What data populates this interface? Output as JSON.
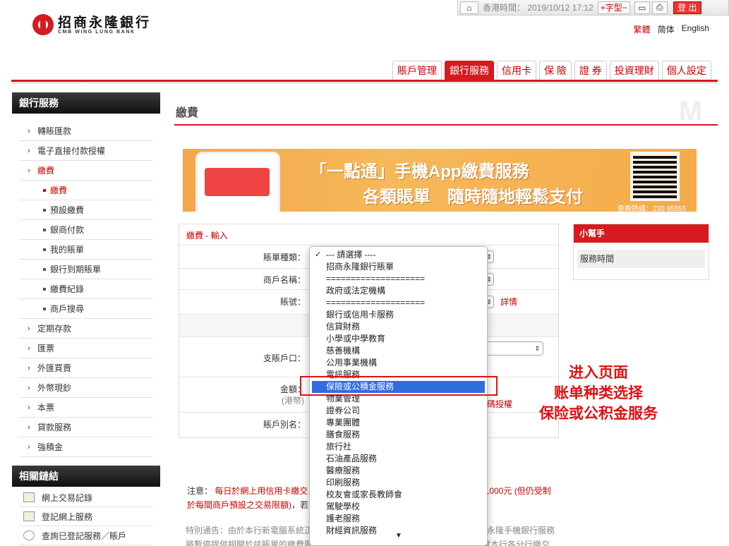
{
  "header": {
    "logo_cn": "招商永隆銀行",
    "logo_en": "CMB WING LUNG BANK",
    "clock": "香港時間： 2019/10/12 17:12",
    "font_label": "字型",
    "logout_label": "登 出",
    "lang": {
      "tc": "繁體",
      "sc": "简体",
      "en": "English"
    }
  },
  "nav": {
    "tabs": [
      "賬戶管理",
      "銀行服務",
      "信用卡",
      "保 險",
      "證 券",
      "投資理財",
      "個人設定"
    ],
    "active": "銀行服務"
  },
  "sidebar": {
    "title": "銀行服務",
    "items": [
      {
        "label": "轉賬匯款"
      },
      {
        "label": "電子直接付款授權"
      },
      {
        "label": "繳費"
      }
    ],
    "sub_items": [
      "繳費",
      "預設繳費",
      "銀商付款",
      "我的賬單",
      "銀行到期賬單",
      "繳費紀錄",
      "商戶搜尋"
    ],
    "more_items": [
      "定期存款",
      "匯票",
      "外匯買賣",
      "外幣現鈔",
      "本票",
      "貸款服務",
      "強積金"
    ],
    "links_title": "相關鏈結",
    "links": [
      "網上交易記錄",
      "登記網上服務",
      "查詢已登記服務／賬戶"
    ]
  },
  "main": {
    "page_title": "繳費",
    "banner": {
      "line1": "「一點通」手機App繳費服務",
      "line2": "各類賬單　隨時隨地輕鬆支付",
      "hotline": "查詢熱綫：230 95555"
    },
    "form": {
      "crumb": "繳費 - 輸入",
      "bill_type_label": "賬單種類：",
      "merchant_label": "商戶名稱：",
      "bill_no_label": "賬號：",
      "details_link": "詳情",
      "account_label": "支賬戶口：",
      "amount_label": "金額：",
      "amount_unit": "(港幣)",
      "code_auth": "碼授權",
      "alias_label": "賬戶別名："
    },
    "helper": {
      "title": "小幫手",
      "item": "服務時間"
    },
    "notice": {
      "prefix": "注意：",
      "red_text": "每日於網上用信用卡繳交",
      "line2_red": "於每間商戶預設之交易限額)",
      "line2_rest": "，若",
      "right_text": ",000元 (但仍受制"
    },
    "special": {
      "text": "特別通告：由於本行新電腦系統正",
      "line2": "將暫停提供相關於該賬單的繳費服務，直至另行通知，服務暫停期間，客戶應瀏覽本行各分行繳交",
      "right_text": "永隆手機銀行服務"
    }
  },
  "dropdown": {
    "options": [
      "--- 請選擇 ----",
      "招商永隆銀行賬單",
      "====================",
      "政府或法定機構",
      "====================",
      "銀行或信用卡服務",
      "信貸財務",
      "小學或中學教育",
      "慈善機構",
      "公用事業機構",
      "電訊服務",
      "保險或公積金服務",
      "物業管理",
      "證券公司",
      "專業團體",
      "膳食服務",
      "旅行社",
      "石油產品服務",
      "醫療服務",
      "印刷服務",
      "校友會或家長教師會",
      "駕駛學校",
      "護老服務",
      "財經資訊服務"
    ],
    "checked_index": 0,
    "highlighted_index": 11
  },
  "annotation": {
    "line1": "进入页面",
    "line2": "账单种类选择",
    "line3": "保险或公积金服务"
  },
  "colors": {
    "brand_red": "#d71920",
    "highlight_blue": "#2f6ee0",
    "annotation_red": "#e01010"
  }
}
